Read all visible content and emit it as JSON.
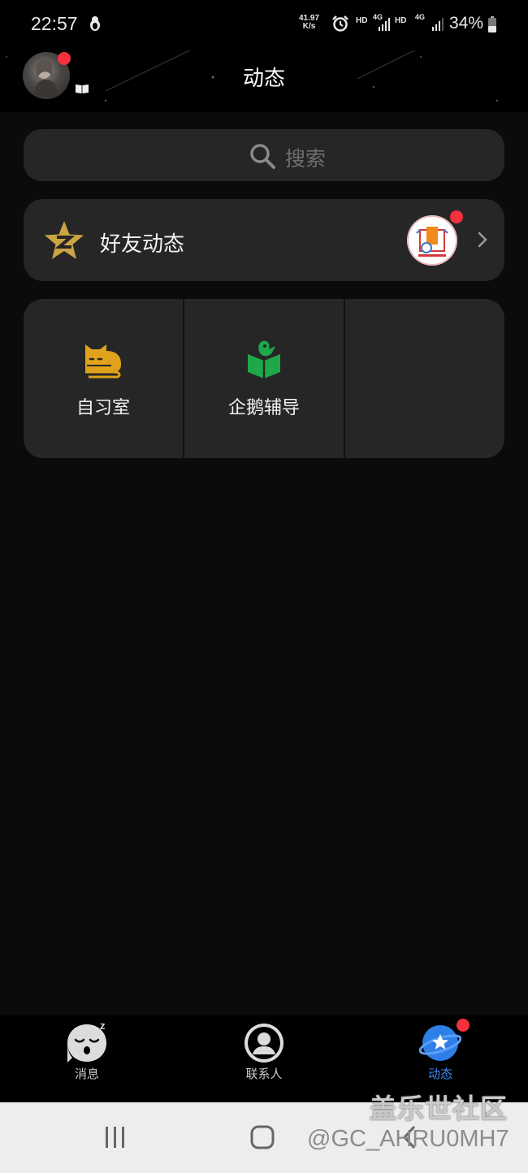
{
  "status_bar": {
    "time": "22:57",
    "net_speed_value": "41.97",
    "net_speed_unit": "K/s",
    "sim1_label": "HD",
    "sim1_net": "4G",
    "sim2_label": "HD",
    "sim2_net": "4G",
    "battery": "34%"
  },
  "header": {
    "title": "动态"
  },
  "search": {
    "placeholder": "搜索"
  },
  "friends_feed": {
    "label": "好友动态"
  },
  "apps": [
    {
      "label": "自习室",
      "icon": "cat-icon"
    },
    {
      "label": "企鹅辅导",
      "icon": "penguin-book-icon"
    }
  ],
  "tab_bar": {
    "tabs": [
      {
        "label": "消息",
        "icon": "sleeping-face-icon",
        "active": false
      },
      {
        "label": "联系人",
        "icon": "person-icon",
        "active": false
      },
      {
        "label": "动态",
        "icon": "planet-star-icon",
        "active": true
      }
    ]
  },
  "watermark": {
    "site": "盖乐世社区",
    "handle": "@GC_AHRU0MH7"
  },
  "colors": {
    "background": "#0b0b0b",
    "card": "#262626",
    "accent_blue": "#3d8df5",
    "badge_red": "#f5313e",
    "qzone_gold": "#c9a544",
    "study_gold": "#e0a21a",
    "penguin_green": "#1fa84a"
  }
}
